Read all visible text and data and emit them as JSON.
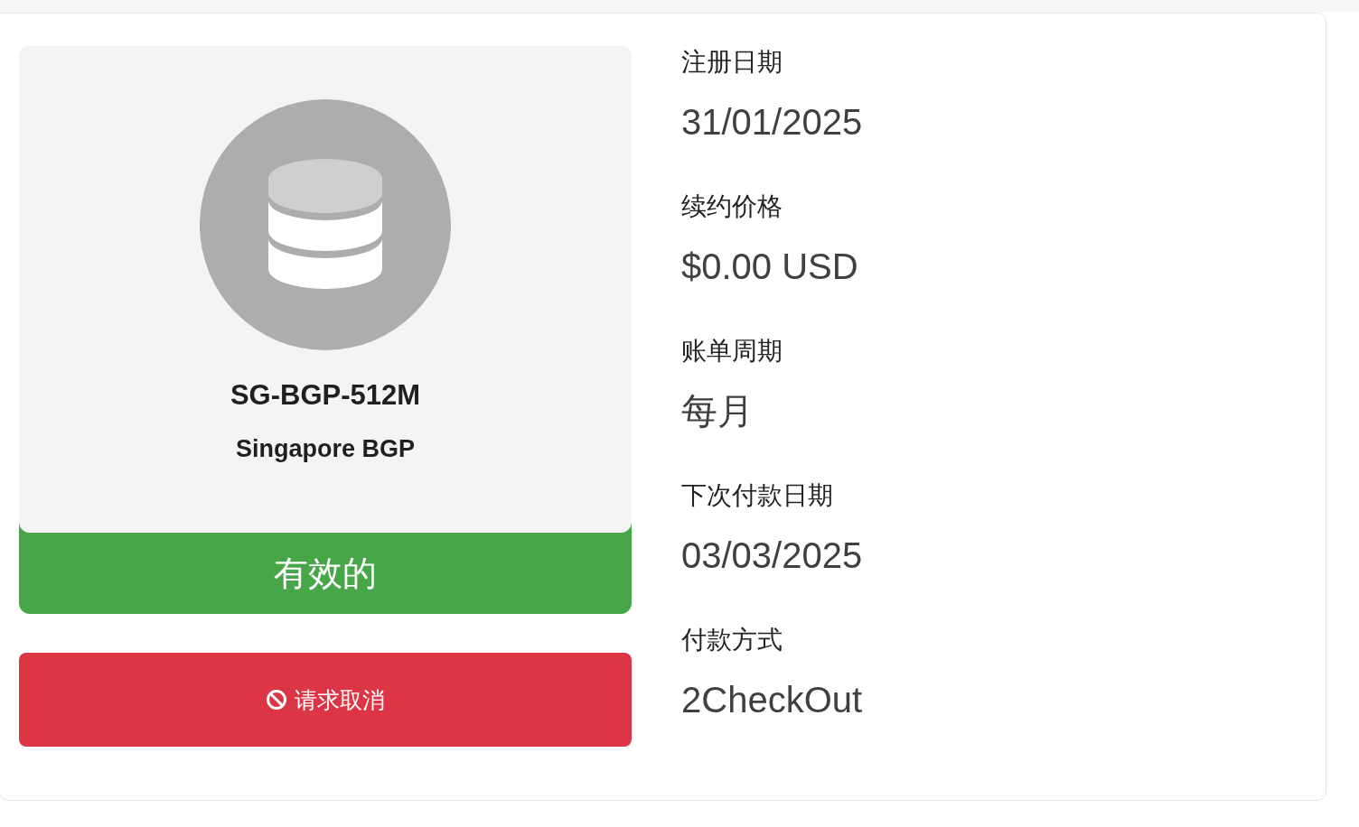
{
  "service": {
    "name": "SG-BGP-512M",
    "group": "Singapore BGP",
    "status": {
      "label": "有效的",
      "kind": "active"
    }
  },
  "actions": [
    {
      "label": "请求取消",
      "kind": "cancel"
    }
  ],
  "details": [
    {
      "label": "注册日期",
      "value": "31/01/2025"
    },
    {
      "label": "续约价格",
      "value": "$0.00 USD"
    },
    {
      "label": "账单周期",
      "value": "每月"
    },
    {
      "label": "下次付款日期",
      "value": "03/03/2025"
    },
    {
      "label": "付款方式",
      "value": "2CheckOut"
    }
  ]
}
